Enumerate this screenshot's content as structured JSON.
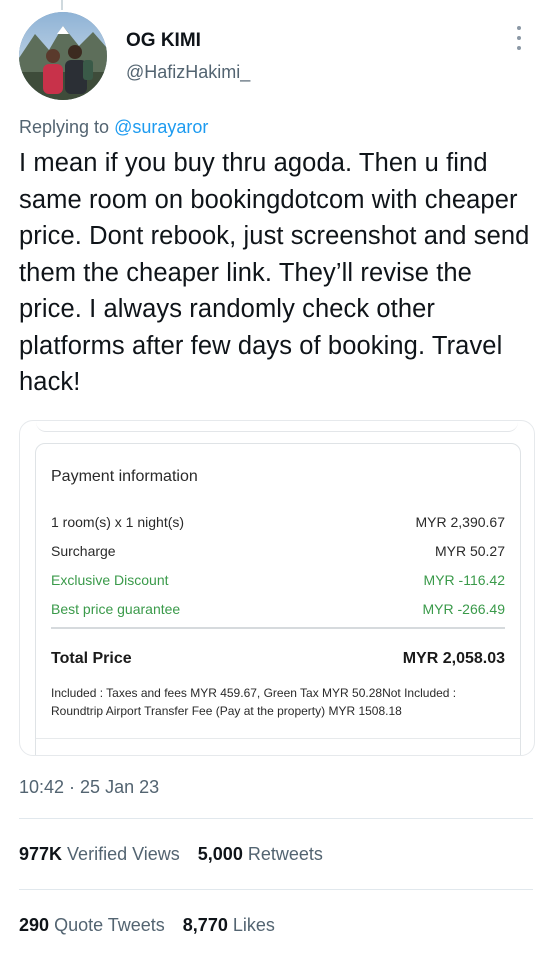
{
  "author": {
    "name": "OG KIMI",
    "handle": "@HafizHakimi_"
  },
  "reply": {
    "prefix": "Replying to",
    "mention": "@surayaror"
  },
  "tweet": {
    "text": "I mean if you buy thru agoda. Then u find same room on bookingdotcom with cheaper price. Dont rebook, just screenshot and send them the cheaper link. They’ll revise the price. I always randomly check other platforms after few days of booking. Travel hack!"
  },
  "payment": {
    "title": "Payment information",
    "rows": [
      {
        "label": "1 room(s) x 1 night(s)",
        "value": "MYR 2,390.67"
      },
      {
        "label": "Surcharge",
        "value": "MYR 50.27"
      },
      {
        "label": "Exclusive Discount",
        "value": "MYR -116.42"
      },
      {
        "label": "Best price guarantee",
        "value": "MYR -266.49"
      }
    ],
    "total_label": "Total Price",
    "total_value": "MYR 2,058.03",
    "note_line1": "Included : Taxes and fees MYR 459.67, Green Tax MYR 50.28Not Included :",
    "note_line2": "Roundtrip Airport Transfer Fee (Pay at the property) MYR 1508.18"
  },
  "meta": {
    "timestamp": "10:42 · 25 Jan 23"
  },
  "stats": {
    "views_count": "977K",
    "views_label": "Verified Views",
    "retweets_count": "5,000",
    "retweets_label": "Retweets",
    "quotes_count": "290",
    "quotes_label": "Quote Tweets",
    "likes_count": "8,770",
    "likes_label": "Likes"
  },
  "colors": {
    "accent": "#1d9bf0",
    "discount_green": "#3a9a4a",
    "muted": "#536471"
  }
}
